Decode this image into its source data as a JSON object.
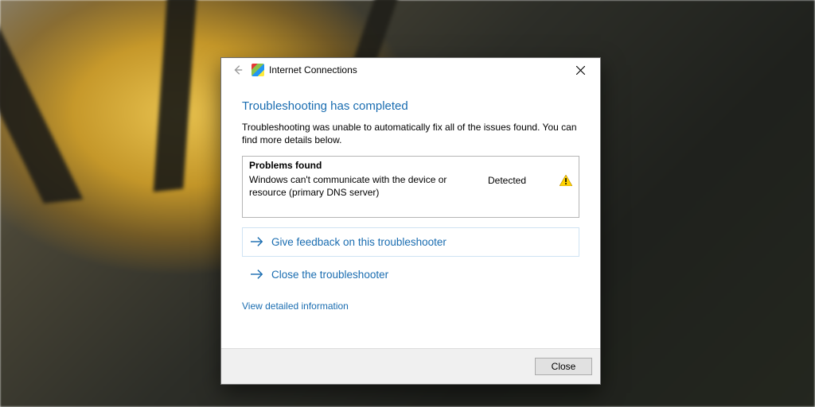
{
  "titlebar": {
    "title": "Internet Connections"
  },
  "heading": "Troubleshooting has completed",
  "subtext": "Troubleshooting was unable to automatically fix all of the issues found. You can find more details below.",
  "problems": {
    "header": "Problems found",
    "items": [
      {
        "description": "Windows can't communicate with the device or resource (primary DNS server)",
        "status": "Detected",
        "severity": "warning"
      }
    ]
  },
  "actions": {
    "feedback": "Give feedback on this troubleshooter",
    "close_troubleshooter": "Close the troubleshooter"
  },
  "detail_link": "View detailed information",
  "buttons": {
    "close": "Close"
  }
}
